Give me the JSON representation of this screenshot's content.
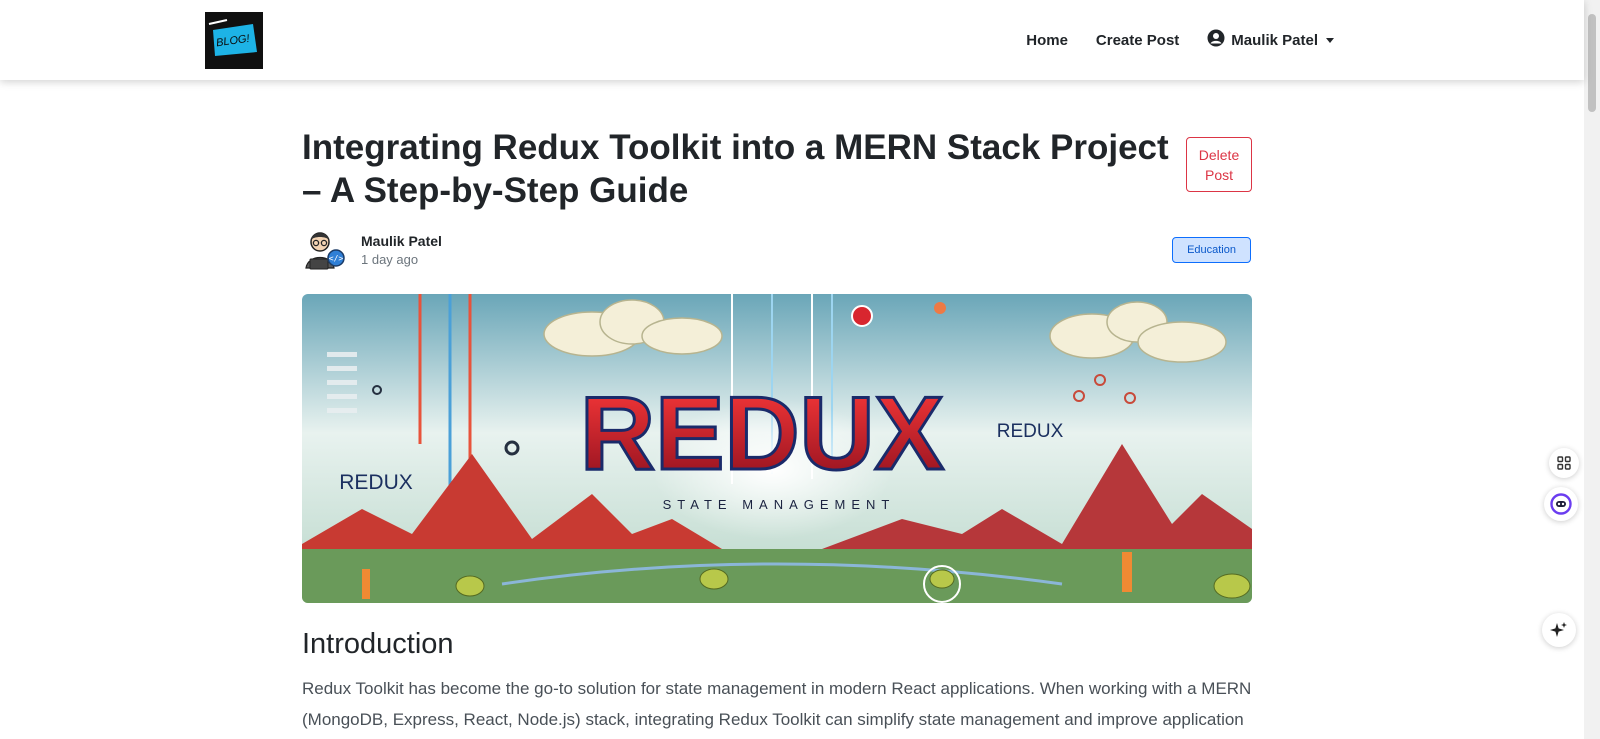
{
  "nav": {
    "logo_text": "BLOG!",
    "home": "Home",
    "create_post": "Create Post",
    "user_name": "Maulik Patel"
  },
  "post": {
    "title": "Integrating Redux Toolkit into a MERN Stack Project – A Step-by-Step Guide",
    "delete_label": "Delete Post",
    "author": "Maulik Patel",
    "time": "1 day ago",
    "category": "Education",
    "hero_big": "REDUX",
    "hero_small_left": "REDUX",
    "hero_small_right": "REDUX",
    "hero_subtitle": "STATE MANAGEMENT",
    "intro_heading": "Introduction",
    "intro_text": "Redux Toolkit has become the go-to solution for state management in modern React applications. When working with a MERN (MongoDB, Express, React, Node.js) stack, integrating Redux Toolkit can simplify state management and improve application"
  },
  "colors": {
    "danger": "#dc3545",
    "badge_bg": "#cfe2ff",
    "badge_border": "#0d6efd"
  },
  "icons": [
    "user-circle-icon",
    "caret-down-icon",
    "apps-icon",
    "assistant-icon",
    "sparkle-icon"
  ]
}
